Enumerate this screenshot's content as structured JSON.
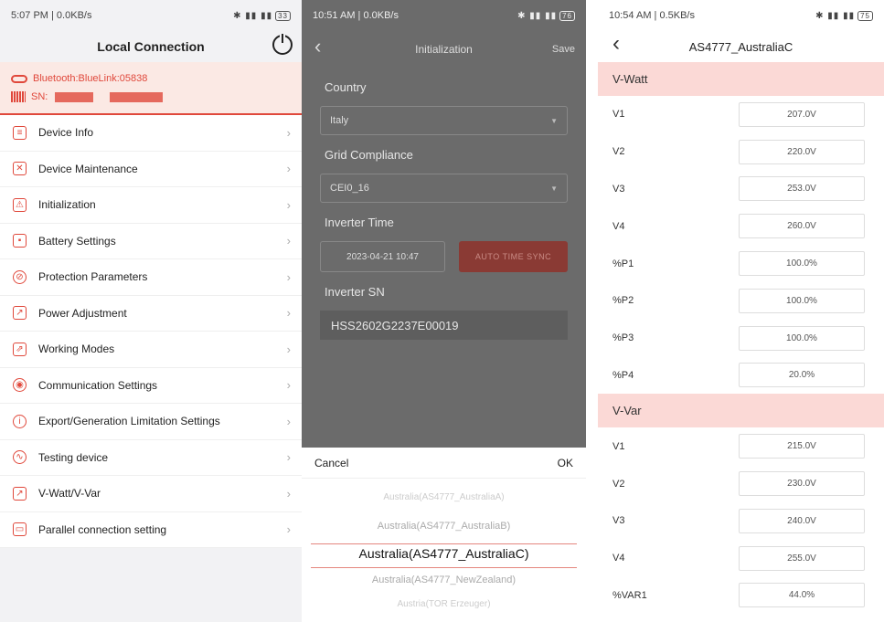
{
  "phone1": {
    "status": {
      "time": "5:07 PM | 0.0KB/s",
      "battery": "33"
    },
    "title": "Local Connection",
    "bluetooth": "Bluetooth:BlueLink:05838",
    "sn_label": "SN:",
    "menu": [
      {
        "label": "Device Info",
        "icon": "list-icon"
      },
      {
        "label": "Device Maintenance",
        "icon": "tools-icon"
      },
      {
        "label": "Initialization",
        "icon": "init-icon"
      },
      {
        "label": "Battery Settings",
        "icon": "battery-icon"
      },
      {
        "label": "Protection Parameters",
        "icon": "shield-icon"
      },
      {
        "label": "Power Adjustment",
        "icon": "chart-icon"
      },
      {
        "label": "Working Modes",
        "icon": "mode-icon"
      },
      {
        "label": "Communication Settings",
        "icon": "antenna-icon"
      },
      {
        "label": "Export/Generation Limitation Settings",
        "icon": "limit-icon"
      },
      {
        "label": "Testing device",
        "icon": "test-icon"
      },
      {
        "label": "V-Watt/V-Var",
        "icon": "graph-icon"
      },
      {
        "label": "Parallel connection setting",
        "icon": "parallel-icon"
      }
    ]
  },
  "phone2": {
    "status": {
      "time": "10:51 AM | 0.0KB/s",
      "battery": "76"
    },
    "title": "Initialization",
    "save": "Save",
    "country_label": "Country",
    "country_value": "Italy",
    "grid_label": "Grid Compliance",
    "grid_value": "CEI0_16",
    "time_label": "Inverter Time",
    "time_value": "2023-04-21 10:47",
    "sync_button": "AUTO TIME SYNC",
    "sn_label": "Inverter SN",
    "sn_value": "HSS2602G2237E00019",
    "cancel": "Cancel",
    "ok": "OK",
    "picker": [
      "Australia(AS4777_AustraliaA)",
      "Australia(AS4777_AustraliaB)",
      "Australia(AS4777_AustraliaC)",
      "Australia(AS4777_NewZealand)",
      "Austria(TOR Erzeuger)"
    ]
  },
  "phone3": {
    "status": {
      "time": "10:54 AM | 0.5KB/s",
      "battery": "75"
    },
    "title": "AS4777_AustraliaC",
    "vwatt_title": "V-Watt",
    "vwatt": [
      {
        "label": "V1",
        "value": "207.0V"
      },
      {
        "label": "V2",
        "value": "220.0V"
      },
      {
        "label": "V3",
        "value": "253.0V"
      },
      {
        "label": "V4",
        "value": "260.0V"
      },
      {
        "label": "%P1",
        "value": "100.0%"
      },
      {
        "label": "%P2",
        "value": "100.0%"
      },
      {
        "label": "%P3",
        "value": "100.0%"
      },
      {
        "label": "%P4",
        "value": "20.0%"
      }
    ],
    "vvar_title": "V-Var",
    "vvar": [
      {
        "label": "V1",
        "value": "215.0V"
      },
      {
        "label": "V2",
        "value": "230.0V"
      },
      {
        "label": "V3",
        "value": "240.0V"
      },
      {
        "label": "V4",
        "value": "255.0V"
      },
      {
        "label": "%VAR1",
        "value": "44.0%"
      }
    ]
  },
  "colors": {
    "accent": "#e0483b",
    "section_bg": "#fbd9d6",
    "dim_overlay": "#6b6b6b"
  }
}
